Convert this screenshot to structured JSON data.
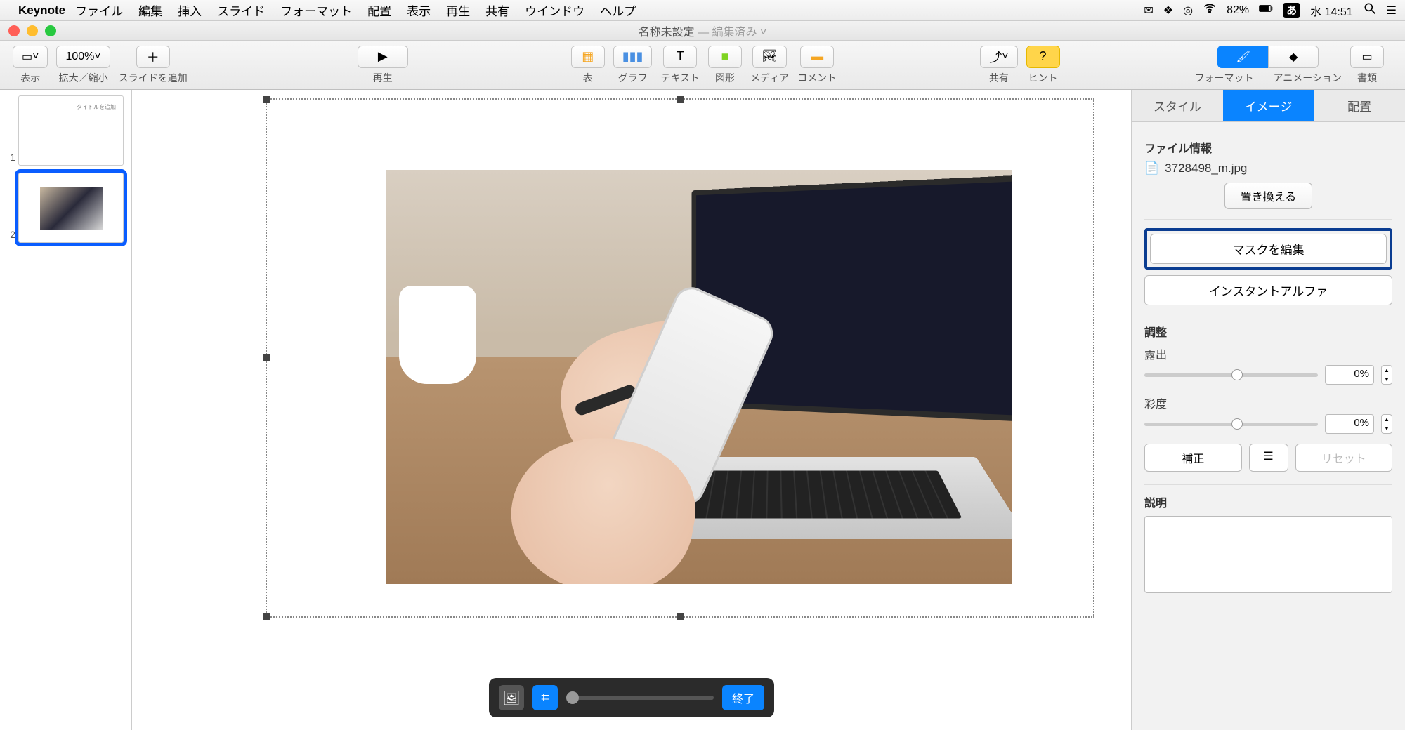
{
  "menubar": {
    "app": "Keynote",
    "items": [
      "ファイル",
      "編集",
      "挿入",
      "スライド",
      "フォーマット",
      "配置",
      "表示",
      "再生",
      "共有",
      "ウインドウ",
      "ヘルプ"
    ],
    "battery": "82%",
    "ime": "あ",
    "clock": "水 14:51"
  },
  "window": {
    "title": "名称未設定",
    "subtitle": "— 編集済み ˅"
  },
  "toolbar": {
    "view": "表示",
    "zoom_val": "100%",
    "zoom": "拡大／縮小",
    "add": "スライドを追加",
    "play": "再生",
    "table": "表",
    "chart": "グラフ",
    "text": "テキスト",
    "shape": "図形",
    "media": "メディア",
    "comment": "コメント",
    "share": "共有",
    "hint": "ヒント",
    "format": "フォーマット",
    "anim": "アニメーション",
    "doc": "書類"
  },
  "slides": {
    "n1": "1",
    "n2": "2"
  },
  "maskpop": {
    "done": "終了"
  },
  "inspector": {
    "tabs": {
      "style": "スタイル",
      "image": "イメージ",
      "arrange": "配置"
    },
    "fileinfo_label": "ファイル情報",
    "filename": "3728498_m.jpg",
    "replace": "置き換える",
    "edit_mask": "マスクを編集",
    "instant_alpha": "インスタントアルファ",
    "adjust": "調整",
    "exposure": "露出",
    "exposure_val": "0%",
    "saturation": "彩度",
    "saturation_val": "0%",
    "enhance": "補正",
    "reset": "リセット",
    "description": "説明"
  }
}
